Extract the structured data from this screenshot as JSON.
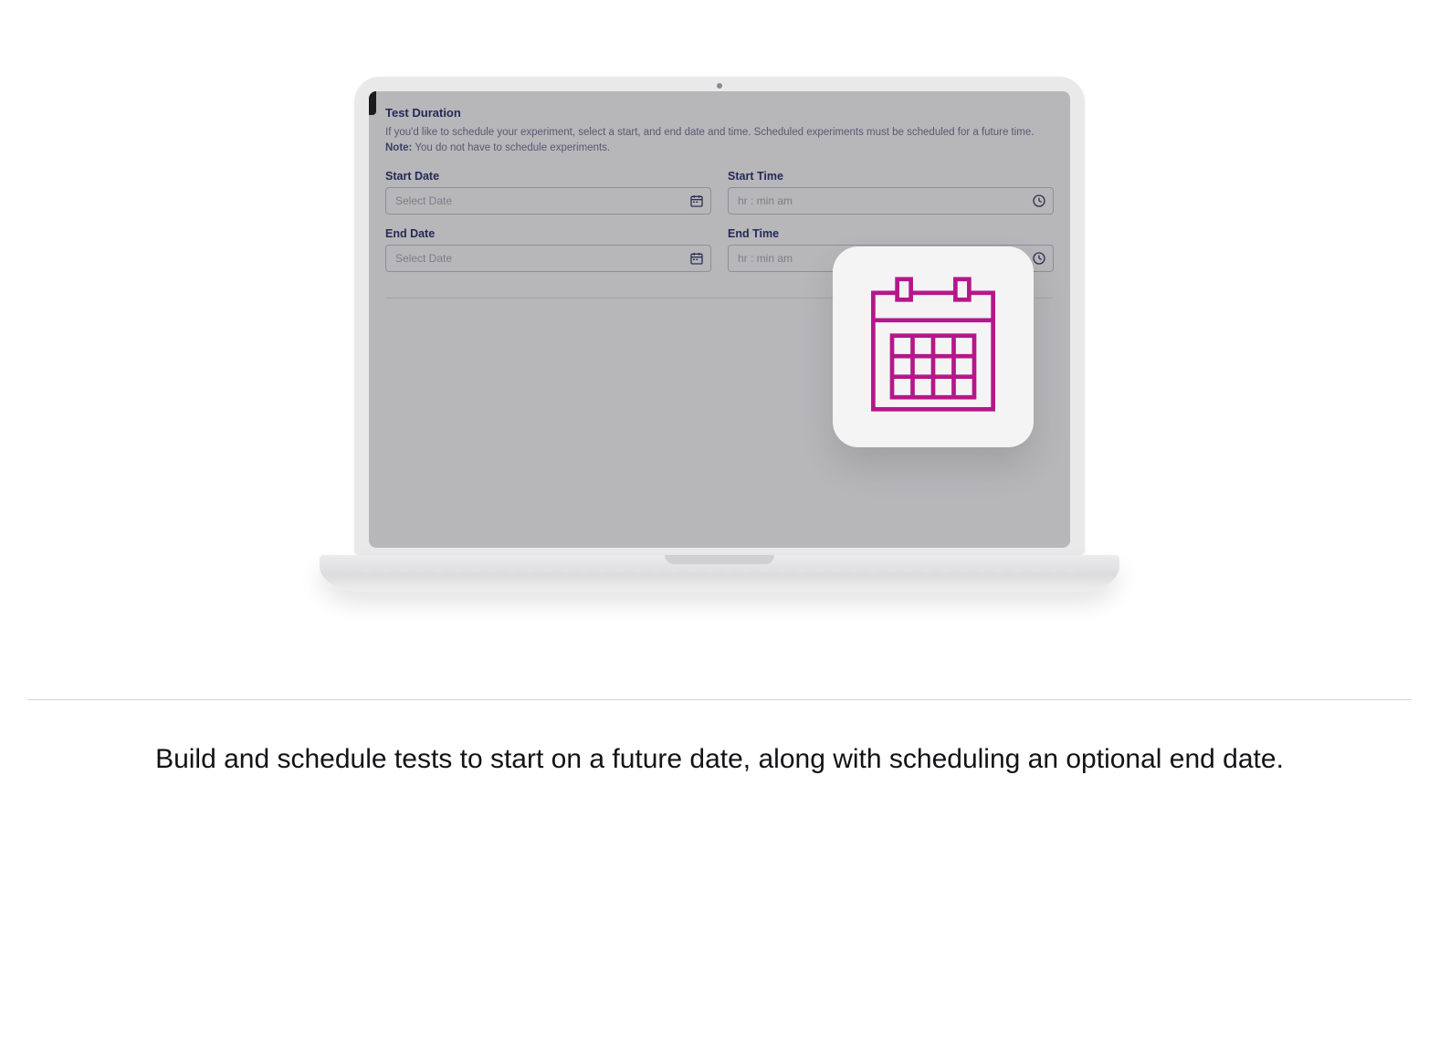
{
  "panel": {
    "title": "Test Duration",
    "description": "If you'd like to schedule your experiment, select a start, and end date and time. Scheduled experiments must be scheduled for a future time.",
    "note_label": "Note:",
    "note_text": " You do not have to schedule experiments."
  },
  "fields": {
    "start_date": {
      "label": "Start Date",
      "placeholder": "Select Date"
    },
    "start_time": {
      "label": "Start Time",
      "placeholder": "hr : min   am"
    },
    "end_date": {
      "label": "End Date",
      "placeholder": "Select Date"
    },
    "end_time": {
      "label": "End Time",
      "placeholder": "hr : min   am"
    }
  },
  "caption": "Build and schedule tests to start on a future date, along with scheduling an optional end date.",
  "colors": {
    "accent": "#b5178a",
    "label": "#242a56",
    "muted": "#7d7d86"
  }
}
